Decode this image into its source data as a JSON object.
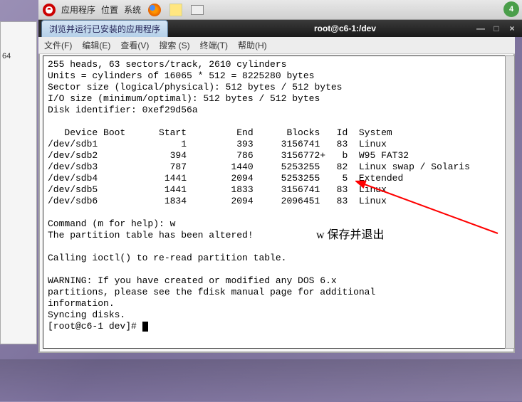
{
  "taskbar": {
    "apps": "应用程序",
    "places": "位置",
    "system": "系统"
  },
  "corner": "4",
  "left_text": "64",
  "tab_label": "浏览并运行已安装的应用程序",
  "window_title": "root@c6-1:/dev",
  "win_controls": {
    "min": "—",
    "max": "□",
    "close": "×"
  },
  "menu": {
    "file": "文件(F)",
    "edit": "编辑(E)",
    "view": "查看(V)",
    "search": "搜索 (S)",
    "terminal": "终端(T)",
    "help": "帮助(H)"
  },
  "terminal_lines": [
    "255 heads, 63 sectors/track, 2610 cylinders",
    "Units = cylinders of 16065 * 512 = 8225280 bytes",
    "Sector size (logical/physical): 512 bytes / 512 bytes",
    "I/O size (minimum/optimal): 512 bytes / 512 bytes",
    "Disk identifier: 0xef29d56a",
    "",
    "   Device Boot      Start         End      Blocks   Id  System",
    "/dev/sdb1               1         393     3156741   83  Linux",
    "/dev/sdb2             394         786     3156772+   b  W95 FAT32",
    "/dev/sdb3             787        1440     5253255   82  Linux swap / Solaris",
    "/dev/sdb4            1441        2094     5253255    5  Extended",
    "/dev/sdb5            1441        1833     3156741   83  Linux",
    "/dev/sdb6            1834        2094     2096451   83  Linux",
    "",
    "Command (m for help): w",
    "The partition table has been altered!",
    "",
    "Calling ioctl() to re-read partition table.",
    "",
    "WARNING: If you have created or modified any DOS 6.x",
    "partitions, please see the fdisk manual page for additional",
    "information.",
    "Syncing disks.",
    "[root@c6-1 dev]# "
  ],
  "annotation": "w 保存并退出"
}
